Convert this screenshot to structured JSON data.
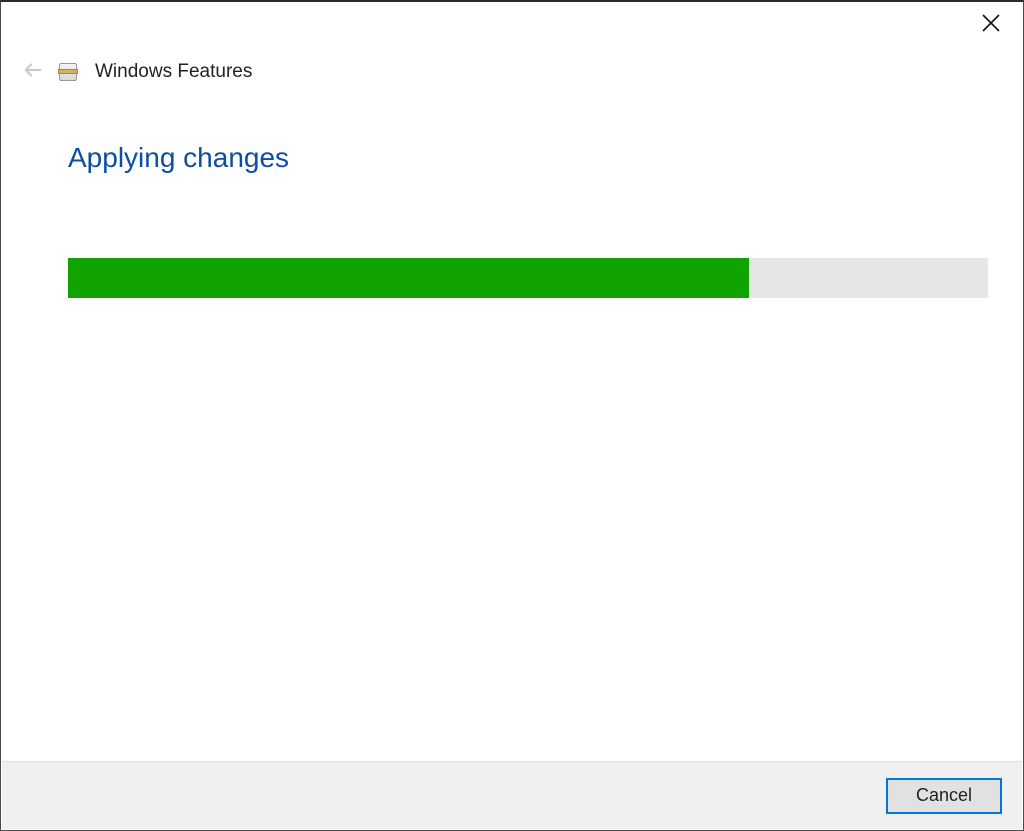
{
  "window": {
    "title": "Windows Features"
  },
  "heading": "Applying changes",
  "progress": {
    "percent": 74,
    "track_color": "#e6e6e6",
    "fill_color": "#11a400"
  },
  "footer": {
    "cancel_label": "Cancel"
  }
}
